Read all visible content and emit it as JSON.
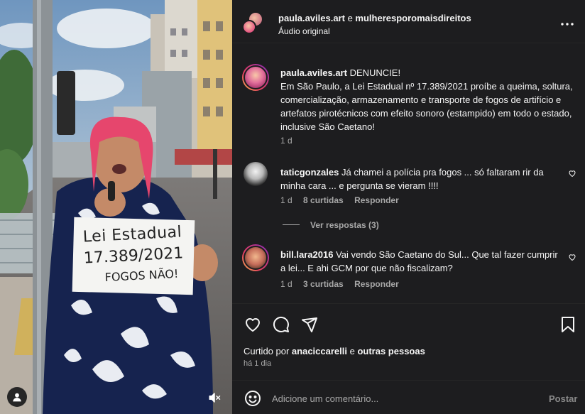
{
  "header": {
    "user1": "paula.aviles.art",
    "conj": " e ",
    "user2": "mulheresporomaisdireitos",
    "subtitle": "Áudio original"
  },
  "caption": {
    "user": "paula.aviles.art",
    "text_line1": " DENUNCIE!",
    "text_rest": "Em São Paulo, a Lei Estadual nº 17.389/2021 proíbe a queima, soltura, comercialização, armazenamento e transporte de fogos de artifício e artefatos pirotécnicos com efeito sonoro (estampido) em todo o estado, inclusive São Caetano!",
    "time": "1 d"
  },
  "comments": [
    {
      "user": "taticgonzales",
      "text": " Já chamei a polícia pra fogos ... só faltaram rir da minha cara ... e pergunta se vieram !!!!",
      "time": "1 d",
      "likes": "8 curtidas",
      "reply": "Responder",
      "view_replies": "Ver respostas (3)"
    },
    {
      "user": "bill.lara2016",
      "text": " Vai vendo São Caetano do Sul... Que tal fazer cumprir a lei... E ahi GCM por que não fiscalizam?",
      "time": "1 d",
      "likes": "3 curtidas",
      "reply": "Responder"
    }
  ],
  "likes": {
    "prefix": "Curtido por ",
    "user": "anaciccarelli",
    "mid": " e ",
    "rest": "outras pessoas"
  },
  "post_time": "há 1 dia",
  "composer": {
    "placeholder": "Adicione um comentário...",
    "post": "Postar"
  },
  "sign": {
    "line1": "Lei Estadual",
    "line2": "17.389/2021",
    "line3": "FOGOS NÃO!"
  },
  "colors": {
    "panel_bg": "#1d1d1f",
    "muted_text": "#a8a8a8"
  },
  "icons": [
    "more-icon",
    "heart-icon",
    "comment-icon",
    "share-icon",
    "bookmark-icon",
    "emoji-icon",
    "user-tag-icon",
    "muted-icon"
  ]
}
